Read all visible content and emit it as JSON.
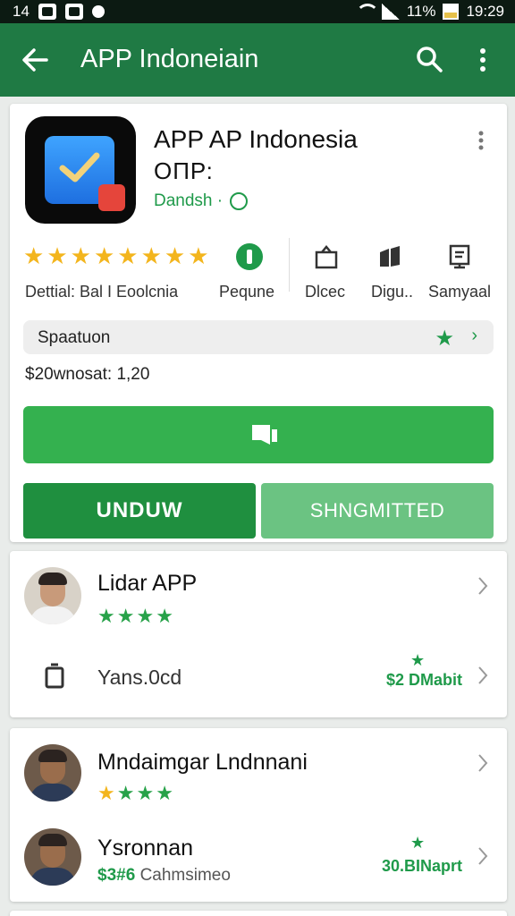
{
  "status_bar": {
    "time_left": "14",
    "battery_pct": "11%",
    "time_right": "19:29"
  },
  "app_bar": {
    "title": "APP Indoneiain"
  },
  "app": {
    "name": "APP AP Indonesia",
    "subtitle": "ОПР:",
    "developer": "Dandsh ·",
    "rating_stars": 8,
    "stats": [
      {
        "icon": "shield-icon",
        "label": "Pequne"
      },
      {
        "icon": "bag-icon",
        "label": "Dlcec"
      },
      {
        "icon": "bookmark-icon",
        "label": "Digu.."
      },
      {
        "icon": "device-icon",
        "label": "Samyaal"
      }
    ],
    "detail_label": "Dettial: Bal I Eoolcnia",
    "section_pill": "Spaatuon",
    "price_line": "$20wnosat: 1,20",
    "buttons": {
      "left": "UNDUW",
      "right": "SHNGMITTED"
    }
  },
  "list1": {
    "items": [
      {
        "title": "Lidar APP",
        "stars_green": 4
      },
      {
        "title": "Yans.0cd",
        "price": "$2 DMabit"
      }
    ]
  },
  "list2": {
    "items": [
      {
        "title": "Mndaimgar Lndnnani",
        "stars_yellow": 1,
        "stars_green": 3
      },
      {
        "title": "Ysronnan",
        "sub_price": "$3#6",
        "sub_text": "Cahmsimeo",
        "price": "30.BINaprt"
      }
    ]
  },
  "colors": {
    "appbar": "#1f7a44",
    "primary": "#34b14f",
    "install": "#1f8f3f",
    "secondary": "#6bc382",
    "star": "#f3b51d"
  }
}
